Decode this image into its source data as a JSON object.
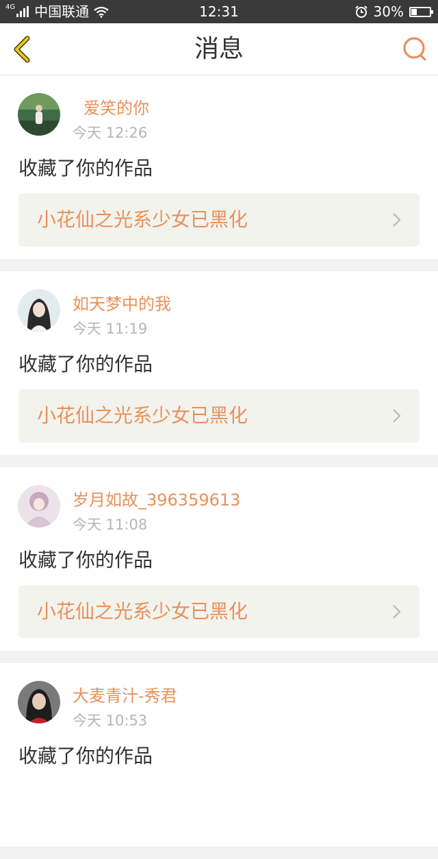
{
  "status_bar": {
    "network_type": "4G",
    "carrier": "中国联通",
    "time": "12:31",
    "battery_percent": "30%",
    "battery_level": 0.3
  },
  "header": {
    "title": "消息"
  },
  "messages": [
    {
      "username": "爱笑的你",
      "time": "今天 12:26",
      "action": "收藏了你的作品",
      "work_title": "小花仙之光系少女已黑化"
    },
    {
      "username": "如天梦中的我",
      "time": "今天 11:19",
      "action": "收藏了你的作品",
      "work_title": "小花仙之光系少女已黑化"
    },
    {
      "username": "岁月如故_396359613",
      "time": "今天 11:08",
      "action": "收藏了你的作品",
      "work_title": "小花仙之光系少女已黑化"
    },
    {
      "username": "大麦青汁-秀君",
      "time": "今天 10:53",
      "action": "收藏了你的作品",
      "work_title": ""
    }
  ],
  "colors": {
    "accent": "#e8915a",
    "back_icon": "#e6c829"
  },
  "icons": {
    "back": "chevron-left-icon",
    "search": "search-icon",
    "link": "chevron-right-icon"
  }
}
